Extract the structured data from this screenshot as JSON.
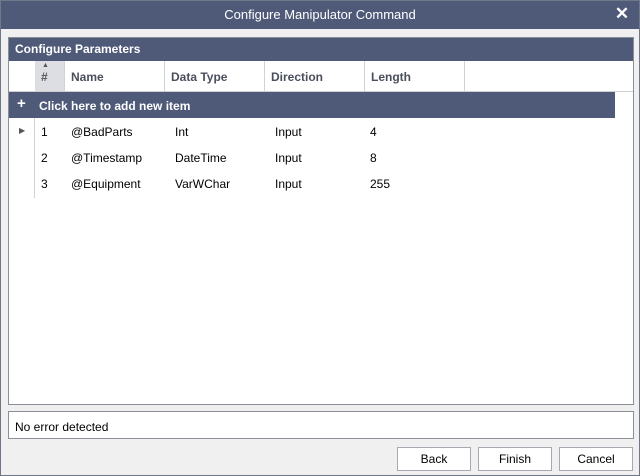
{
  "window": {
    "title": "Configure Manipulator Command",
    "close_icon": "close-icon"
  },
  "panel": {
    "title": "Configure Parameters"
  },
  "grid": {
    "columns": [
      "#",
      "Name",
      "Data Type",
      "Direction",
      "Length"
    ],
    "add_label": "Click here to add new item",
    "rows": [
      {
        "num": "1",
        "name": "@BadParts",
        "type": "Int",
        "direction": "Input",
        "length": "4"
      },
      {
        "num": "2",
        "name": "@Timestamp",
        "type": "DateTime",
        "direction": "Input",
        "length": "8"
      },
      {
        "num": "3",
        "name": "@Equipment",
        "type": "VarWChar",
        "direction": "Input",
        "length": "255"
      }
    ]
  },
  "status": {
    "text": "No error detected"
  },
  "buttons": {
    "back": "Back",
    "finish": "Finish",
    "cancel": "Cancel"
  },
  "colors": {
    "accent": "#4f5a79"
  }
}
